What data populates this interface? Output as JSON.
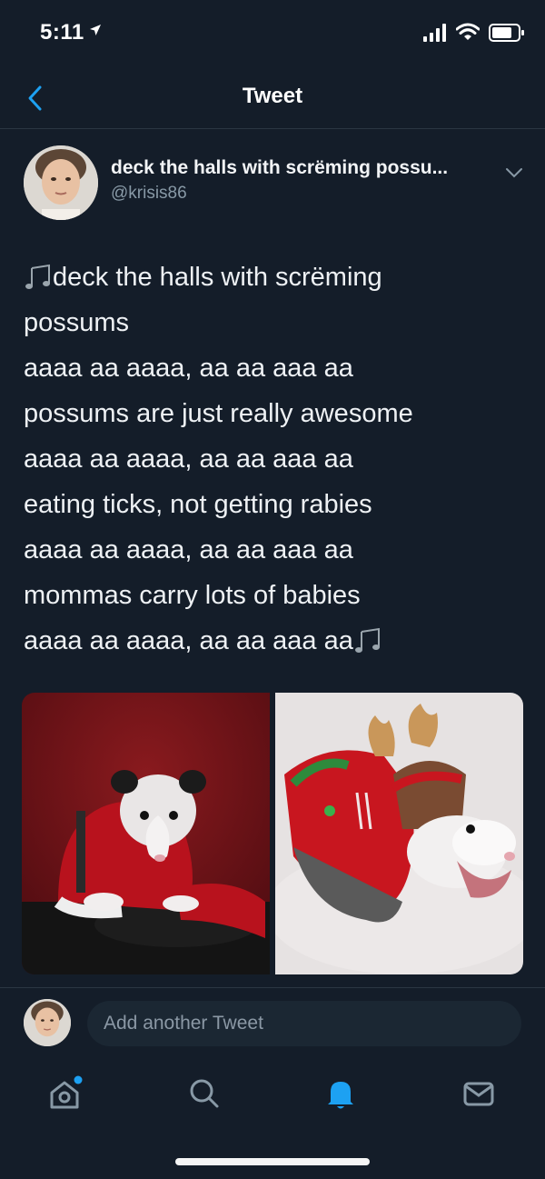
{
  "status_bar": {
    "time": "5:11",
    "icons": [
      "location-arrow-icon",
      "signal-icon",
      "wifi-icon",
      "battery-icon"
    ]
  },
  "header": {
    "title": "Tweet",
    "back_icon": "chevron-left-icon"
  },
  "tweet": {
    "author_name": "deck the halls with scrëming possu...",
    "author_handle": "@krisis86",
    "lines": [
      "deck the halls with scrëming",
      "possums",
      "aaaa aa aaaa, aa aa aaa aa",
      "possums are just really awesome",
      "aaaa aa aaaa, aa aa aaa aa",
      "eating ticks, not getting rabies",
      "aaaa aa aaaa, aa aa aaa aa",
      "mommas carry lots of babies",
      "aaaa aa aaaa, aa aa aaa aa"
    ],
    "lead_icon": "music-note-icon",
    "trail_icon": "music-note-icon"
  },
  "reply": {
    "placeholder": "Add another Tweet"
  },
  "tab_bar": {
    "items": [
      {
        "icon": "home-icon",
        "active": false,
        "badge": true
      },
      {
        "icon": "search-icon",
        "active": false
      },
      {
        "icon": "notifications-bell-icon",
        "active": true
      },
      {
        "icon": "messages-envelope-icon",
        "active": false
      }
    ]
  },
  "colors": {
    "background": "#141d29",
    "accent": "#1da1f2",
    "secondary_text": "#8899a6",
    "divider": "#2b3642"
  }
}
